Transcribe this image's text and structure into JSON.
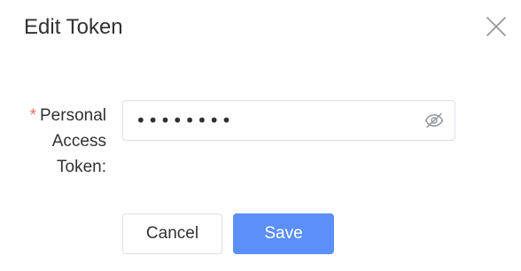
{
  "dialog": {
    "title": "Edit Token",
    "close_icon": "close-icon"
  },
  "form": {
    "required_marker": "*",
    "token_label": "Personal Access Token:",
    "token_value": "12345678",
    "token_input_type": "password",
    "visibility_icon": "eye-off-icon"
  },
  "actions": {
    "cancel_label": "Cancel",
    "save_label": "Save"
  },
  "colors": {
    "primary": "#5b8ff9",
    "required": "#f56c6c",
    "border": "#dcdfe6",
    "text": "#303133"
  }
}
